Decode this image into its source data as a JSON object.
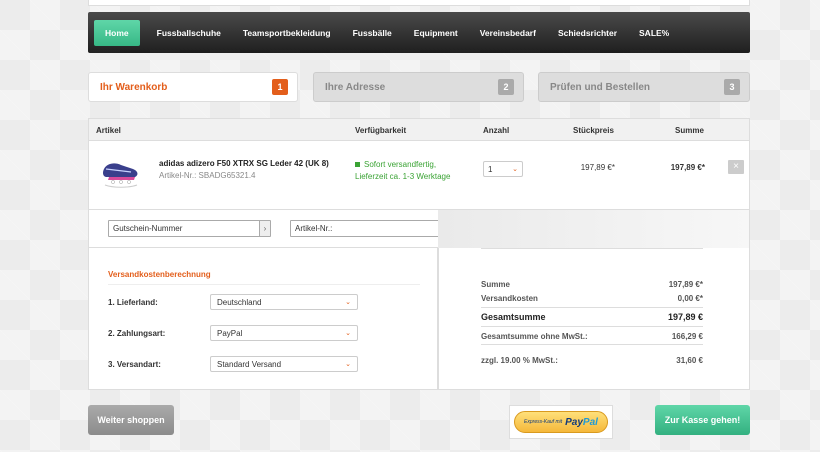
{
  "nav": {
    "items": [
      {
        "label": "Home",
        "active": true
      },
      {
        "label": "Fussballschuhe"
      },
      {
        "label": "Teamsportbekleidung"
      },
      {
        "label": "Fussbälle"
      },
      {
        "label": "Equipment"
      },
      {
        "label": "Vereinsbedarf"
      },
      {
        "label": "Schiedsrichter"
      },
      {
        "label": "SALE%"
      }
    ]
  },
  "steps": [
    {
      "label": "Ihr Warenkorb",
      "number": "1",
      "active": true
    },
    {
      "label": "Ihre Adresse",
      "number": "2"
    },
    {
      "label": "Prüfen und Bestellen",
      "number": "3"
    }
  ],
  "cart": {
    "columns": {
      "article": "Artikel",
      "availability": "Verfügbarkeit",
      "quantity": "Anzahl",
      "unit_price": "Stückpreis",
      "total": "Summe"
    },
    "item": {
      "name": "adidas adizero F50 XTRX SG Leder 42 (UK 8)",
      "sku": "Artikel-Nr.: SBADG65321.4",
      "availability_line1": "Sofort versandfertig,",
      "availability_line2": "Lieferzeit ca. 1-3 Werktage",
      "quantity": "1",
      "unit_price": "197,89 €*",
      "total": "197,89 €*",
      "remove_icon": "×"
    },
    "voucher_input": "Gutschein-Nummer",
    "article_input": "Artikel-Nr.:",
    "input_arrow": "›"
  },
  "shipping": {
    "title": "Versandkostenberechnung",
    "country_label": "1. Lieferland:",
    "country_value": "Deutschland",
    "payment_label": "2. Zahlungsart:",
    "payment_value": "PayPal",
    "method_label": "3. Versandart:",
    "method_value": "Standard Versand"
  },
  "summary": {
    "subtotal_label": "Summe",
    "subtotal_value": "197,89 €*",
    "shipping_label": "Versandkosten",
    "shipping_value": "0,00 €*",
    "total_label": "Gesamtsumme",
    "total_value": "197,89 €",
    "net_label": "Gesamtsumme ohne MwSt.:",
    "net_value": "166,29 €",
    "vat_label": "zzgl. 19.00 % MwSt.:",
    "vat_value": "31,60 €"
  },
  "buttons": {
    "continue_shopping": "Weiter shoppen",
    "paypal_express": "Express-Kauf mit",
    "paypal_logo_a": "Pay",
    "paypal_logo_b": "Pal",
    "checkout": "Zur Kasse gehen!"
  },
  "colors": {
    "accent_orange": "#e35e1b",
    "accent_green": "#37b886",
    "availability_green": "#3aa334"
  }
}
